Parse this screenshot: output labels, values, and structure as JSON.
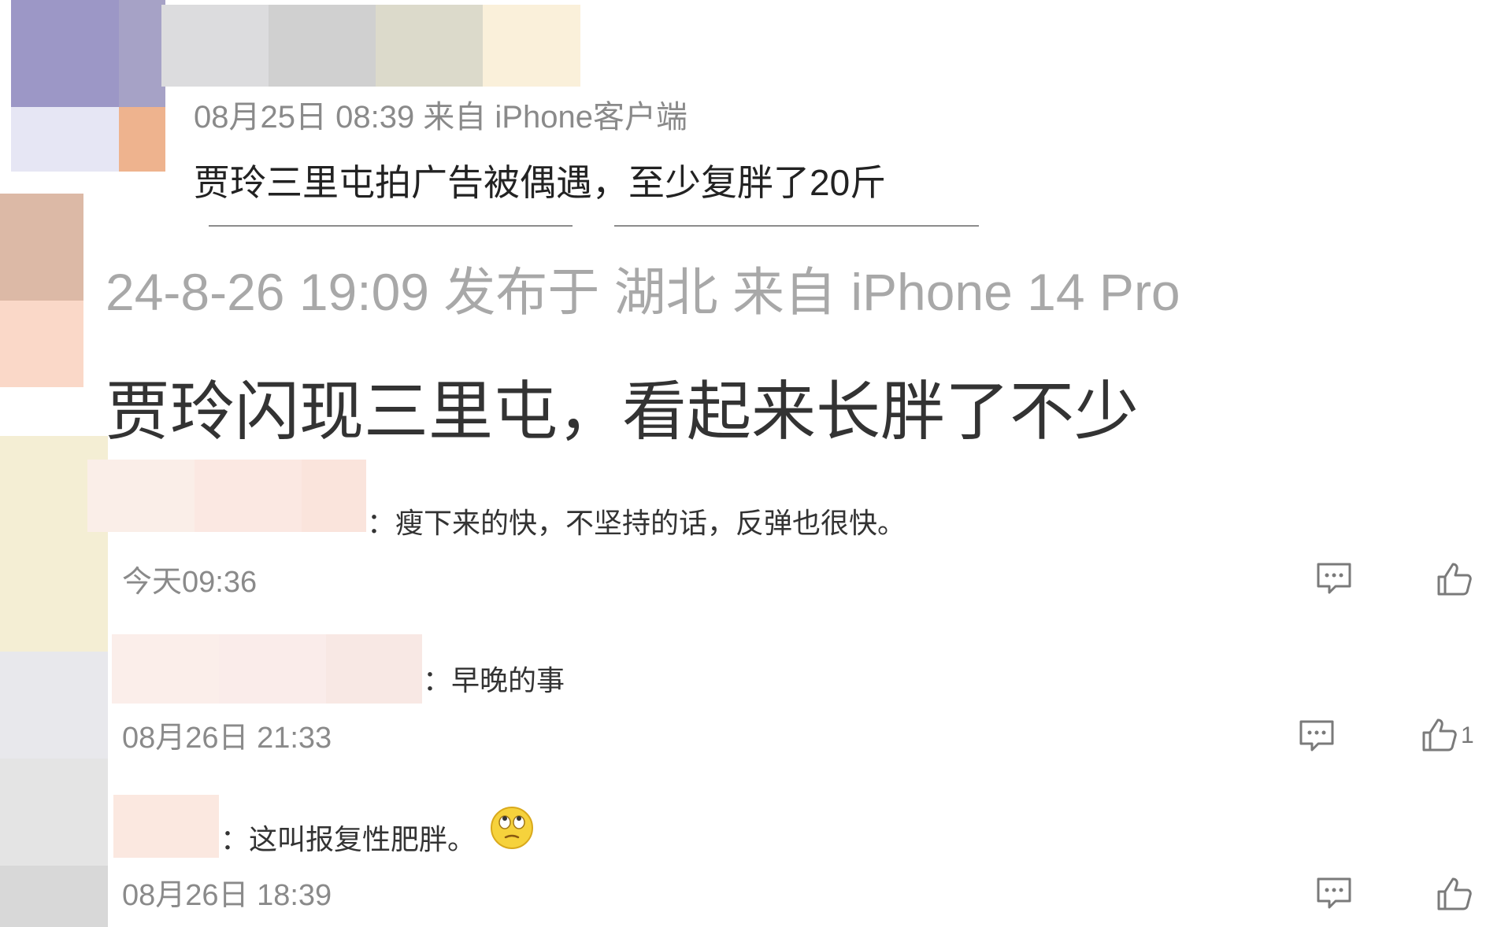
{
  "post_a": {
    "meta": "08月25日 08:39  来自 iPhone客户端",
    "text": "贾玲三里屯拍广告被偶遇，至少复胖了20斤"
  },
  "post_b": {
    "meta": "24-8-26 19:09  发布于 湖北  来自 iPhone 14 Pro",
    "text": "贾玲闪现三里屯，看起来长胖了不少"
  },
  "comments": [
    {
      "text": "：瘦下来的快，不坚持的话，反弹也很快。",
      "time": "今天09:36",
      "likes": ""
    },
    {
      "text": "：早晚的事",
      "time": "08月26日 21:33",
      "likes": "1"
    },
    {
      "text": "：这叫报复性肥胖。",
      "emoji": "rolling-eyes-emoji",
      "time": "08月26日 18:39",
      "likes": ""
    }
  ],
  "icons": {
    "comment": "comment-icon",
    "like": "thumbs-up-icon"
  },
  "colors": {
    "meta_gray": "#8a8a8a",
    "text_dark": "#222222",
    "icon_gray": "#7a7a7a"
  }
}
